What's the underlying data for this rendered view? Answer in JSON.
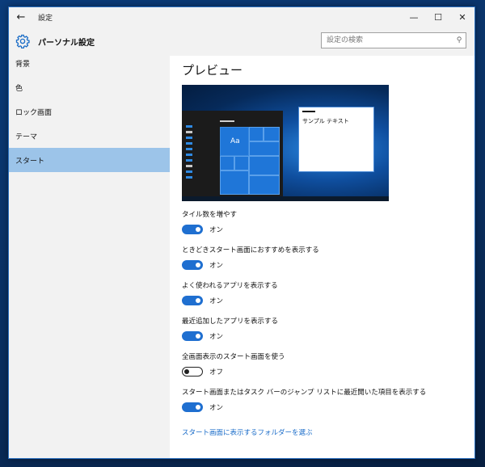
{
  "window": {
    "title": "設定",
    "back_icon": "back-arrow-icon"
  },
  "header": {
    "app_title": "パーソナル設定",
    "search_placeholder": "設定の検索"
  },
  "sidebar": {
    "items": [
      {
        "label": "背景"
      },
      {
        "label": "色"
      },
      {
        "label": "ロック画面"
      },
      {
        "label": "テーマ"
      },
      {
        "label": "スタート",
        "active": true
      }
    ]
  },
  "main": {
    "heading": "プレビュー",
    "preview": {
      "tile_text": "Aa",
      "window_text": "サンプル テキスト"
    },
    "settings": [
      {
        "label": "タイル数を増やす",
        "state": "オン"
      },
      {
        "label": "ときどきスタート画面におすすめを表示する",
        "state": "オン"
      },
      {
        "label": "よく使われるアプリを表示する",
        "state": "オン"
      },
      {
        "label": "最近追加したアプリを表示する",
        "state": "オン"
      },
      {
        "label": "全画面表示のスタート画面を使う",
        "state": "オフ"
      },
      {
        "label": "スタート画面またはタスク バーのジャンプ リストに最近開いた項目を表示する",
        "state": "オン"
      }
    ],
    "link": "スタート画面に表示するフォルダーを選ぶ"
  },
  "colors": {
    "accent": "#1f6fd0",
    "selected": "#9cc4e9",
    "link": "#1a6cc9"
  }
}
